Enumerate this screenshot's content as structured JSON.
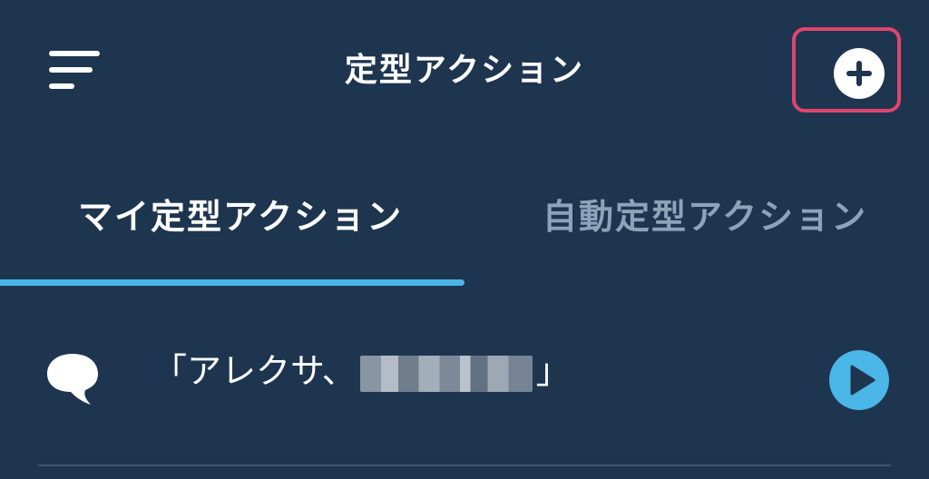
{
  "header": {
    "title": "定型アクション",
    "menu_icon": "hamburger-menu-icon",
    "add_icon": "plus-circle-icon",
    "highlight_color": "#e0456d"
  },
  "tabs": [
    {
      "label": "マイ定型アクション",
      "active": true
    },
    {
      "label": "自動定型アクション",
      "active": false
    }
  ],
  "routines": [
    {
      "phrase_prefix": "「アレクサ、",
      "phrase_suffix": "」",
      "icon": "speech-bubble-icon",
      "play_icon": "play-icon"
    }
  ],
  "colors": {
    "background": "#1e3550",
    "accent": "#4bb6e8",
    "inactive_tab": "#8aa4ba"
  }
}
